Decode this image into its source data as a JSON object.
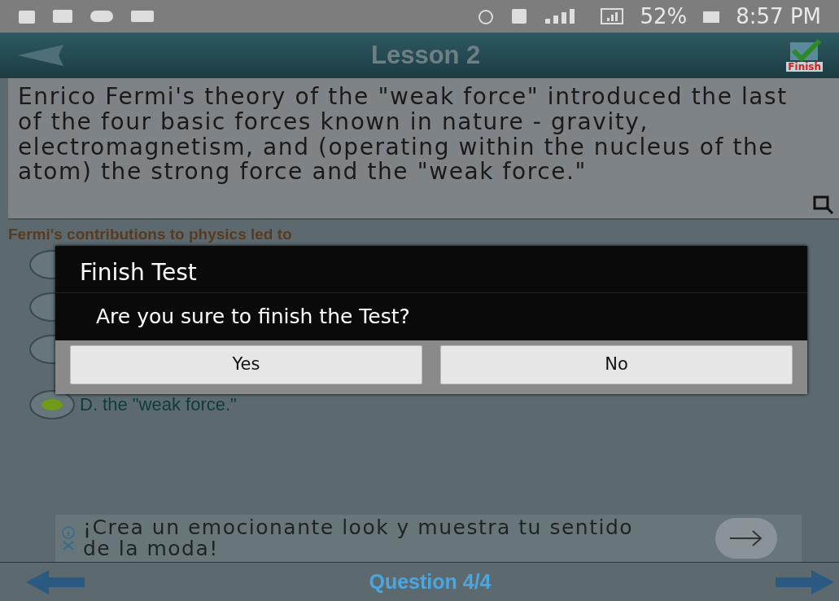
{
  "status_bar": {
    "battery": "52%",
    "time": "8:57 PM"
  },
  "header": {
    "title": "Lesson 2",
    "finish_label": "Finish"
  },
  "passage": "Enrico Fermi's theory of the \"weak force\" introduced the last of the four basic forces known in nature - gravity, electromagnetism, and (operating within the nucleus of the atom) the strong force and the \"weak force.\"",
  "question": "Fermi's contributions to physics led to",
  "options": [
    {
      "selected": false
    },
    {
      "selected": false
    },
    {
      "selected": false
    },
    {
      "label": "D. the \"weak force.\"",
      "selected": true
    }
  ],
  "dialog": {
    "title": "Finish Test",
    "message": "Are you sure to finish the Test?",
    "buttons": [
      "Yes",
      "No"
    ]
  },
  "ad": {
    "text": "¡Crea un emocionante look y muestra tu sentido de la moda!"
  },
  "footer": {
    "label": "Question 4/4"
  }
}
